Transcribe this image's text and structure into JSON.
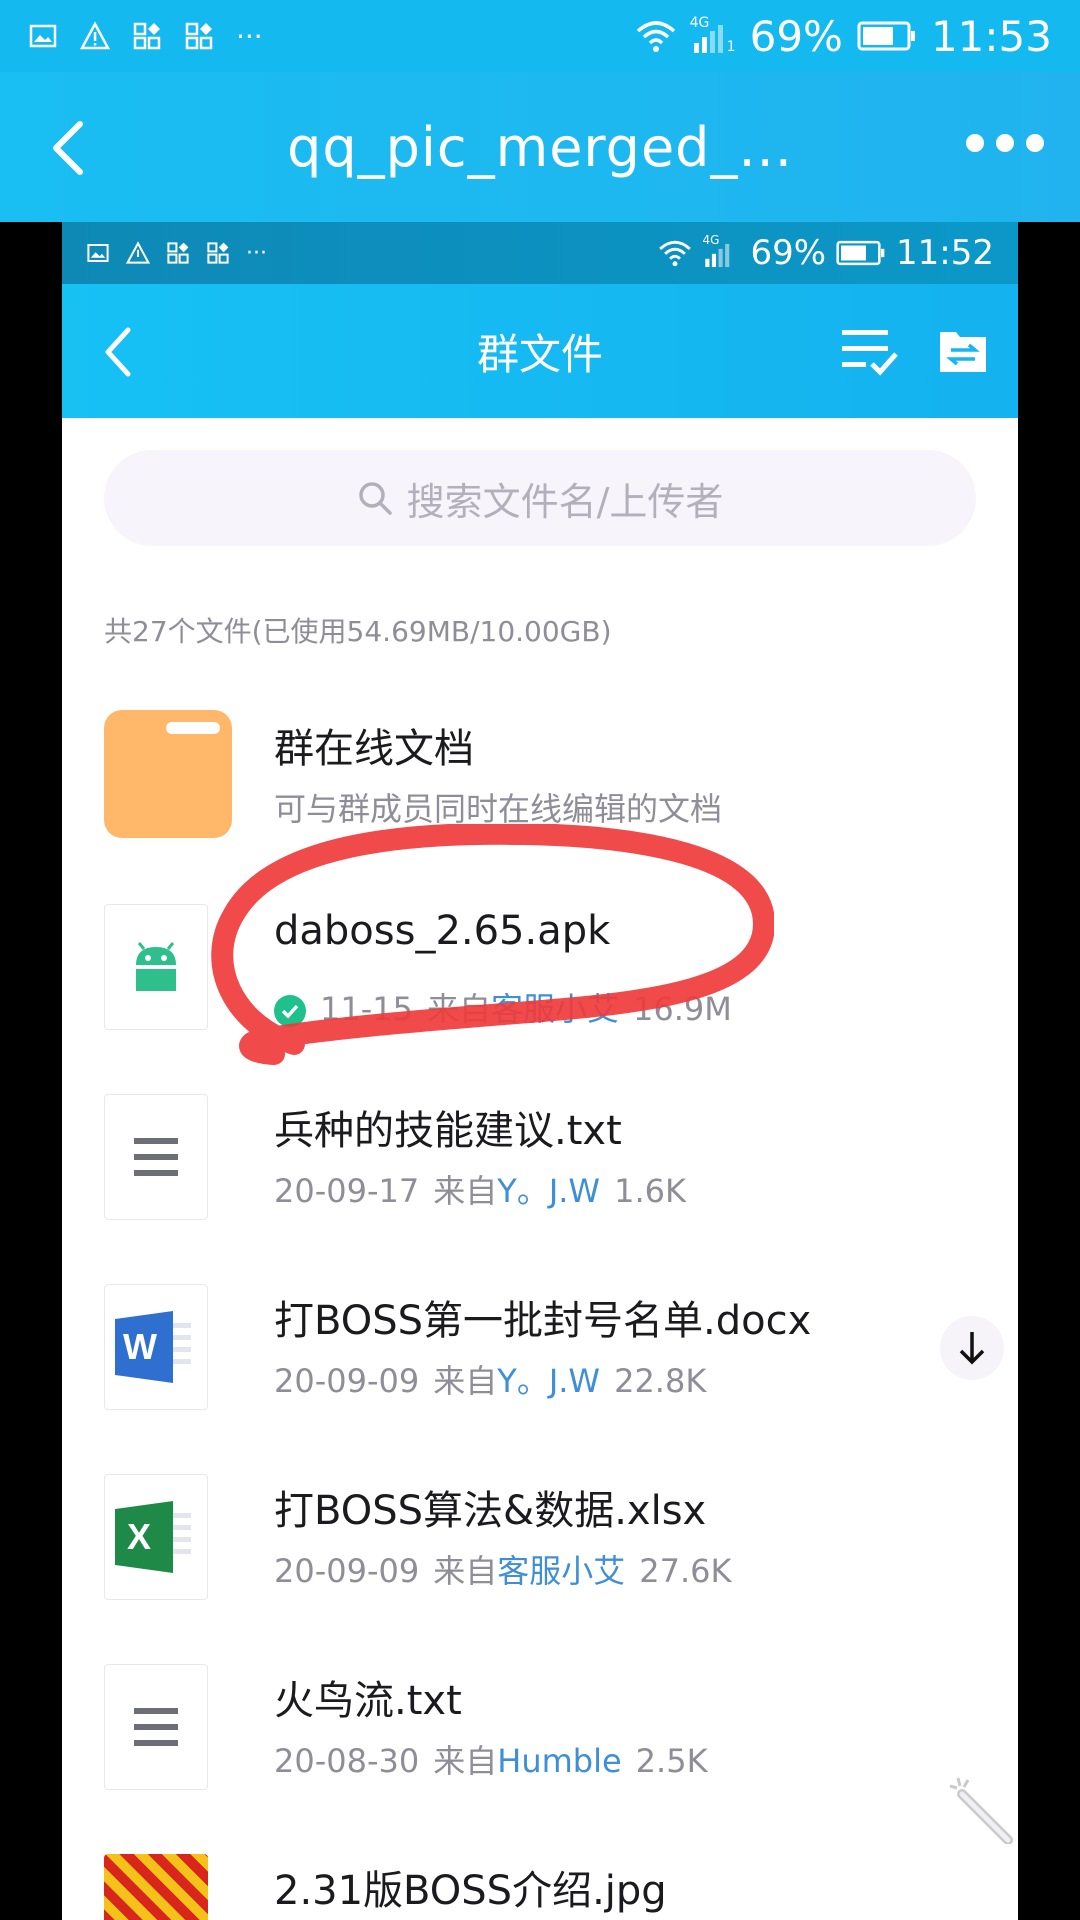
{
  "outer_status": {
    "battery": "69%",
    "time": "11:53",
    "net": "4G",
    "sim": "1",
    "dots": "···"
  },
  "outer_header": {
    "title": "qq_pic_merged_..."
  },
  "inner_status": {
    "battery": "69%",
    "time": "11:52",
    "net": "4G",
    "dots": "···"
  },
  "inner_header": {
    "title": "群文件"
  },
  "search": {
    "placeholder": "搜索文件名/上传者"
  },
  "summary": "共27个文件(已使用54.69MB/10.00GB)",
  "files": [
    {
      "name": "群在线文档",
      "subtitle": "可与群成员同时在线编辑的文档",
      "icon": "folder-icon"
    },
    {
      "name": "daboss_2.65.apk",
      "date": "11-15",
      "from_prefix": "来自",
      "uploader": "客服小艾",
      "size": "16.9M",
      "icon": "android-icon",
      "status": "downloaded"
    },
    {
      "name": "兵种的技能建议.txt",
      "date": "20-09-17",
      "from_prefix": "来自",
      "uploader": "Y。J.W",
      "size": "1.6K",
      "icon": "text-file-icon"
    },
    {
      "name": "打BOSS第一批封号名单.docx",
      "date": "20-09-09",
      "from_prefix": "来自",
      "uploader": "Y。J.W",
      "size": "22.8K",
      "icon": "word-icon"
    },
    {
      "name": "打BOSS算法&数据.xlsx",
      "date": "20-09-09",
      "from_prefix": "来自",
      "uploader": "客服小艾",
      "size": "27.6K",
      "icon": "excel-icon"
    },
    {
      "name": "火鸟流.txt",
      "date": "20-08-30",
      "from_prefix": "来自",
      "uploader": "Humble",
      "size": "2.5K",
      "icon": "text-file-icon"
    },
    {
      "name": "2.31版BOSS介绍.jpg",
      "icon": "image-thumbnail"
    }
  ],
  "colors": {
    "header": "#19bef2",
    "folder": "#ffb869",
    "link": "#3f8fd8",
    "annotation": "#ef3b3b"
  }
}
